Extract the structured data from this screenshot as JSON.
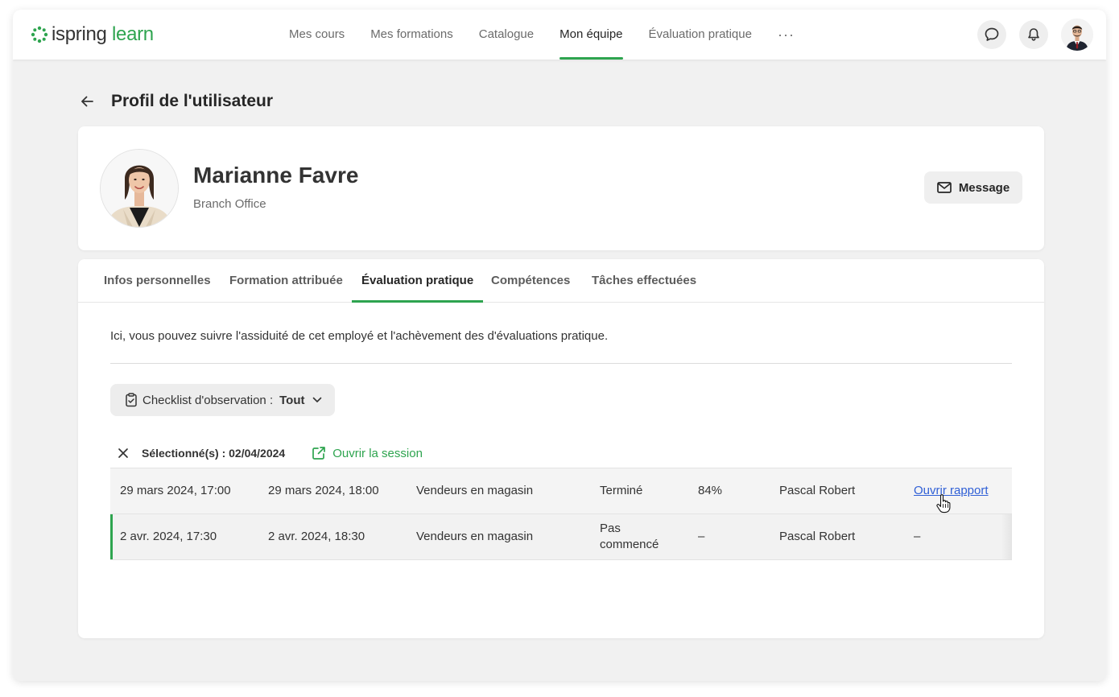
{
  "brand": {
    "part1": "ispring",
    "part2": "learn",
    "accent_color": "#2ea44f"
  },
  "nav": {
    "items": [
      {
        "label": "Mes cours",
        "active": false
      },
      {
        "label": "Mes formations",
        "active": false
      },
      {
        "label": "Catalogue",
        "active": false
      },
      {
        "label": "Mon équipe",
        "active": true
      },
      {
        "label": "Évaluation pratique",
        "active": false
      }
    ],
    "more_label": "···",
    "icons": {
      "chat": "chat-bubble-icon",
      "notifications": "bell-icon",
      "account": "user-avatar"
    }
  },
  "page": {
    "title": "Profil de l'utilisateur"
  },
  "profile": {
    "name": "Marianne Favre",
    "department": "Branch Office",
    "message_label": "Message"
  },
  "tabs": [
    {
      "label": "Infos personnelles",
      "active": false
    },
    {
      "label": "Formation attribuée",
      "active": false
    },
    {
      "label": "Évaluation pratique",
      "active": true
    },
    {
      "label": "Compétences",
      "active": false
    },
    {
      "label": "Tâches effectuées",
      "active": false
    }
  ],
  "evaluation": {
    "description": "Ici, vous pouvez suivre l'assiduité de cet employé et l'achèvement des d'évaluations pratique.",
    "filter": {
      "label": "Checklist d'observation :",
      "value": "Tout"
    },
    "selection": {
      "label": "Sélectionné(s) : 02/04/2024",
      "open_session": "Ouvrir la session"
    },
    "rows": [
      {
        "start": "29 mars 2024, 17:00",
        "end": "29 mars 2024, 18:00",
        "group": "Vendeurs en magasin",
        "status": "Terminé",
        "score": "84%",
        "observer": "Pascal Robert",
        "action": "Ouvrir rapport"
      },
      {
        "start": "2 avr. 2024, 17:30",
        "end": "2 avr. 2024, 18:30",
        "group": "Vendeurs en magasin",
        "status_line1": "Pas",
        "status_line2": "commencé",
        "score": "–",
        "observer": "Pascal Robert",
        "action": "–"
      }
    ]
  }
}
